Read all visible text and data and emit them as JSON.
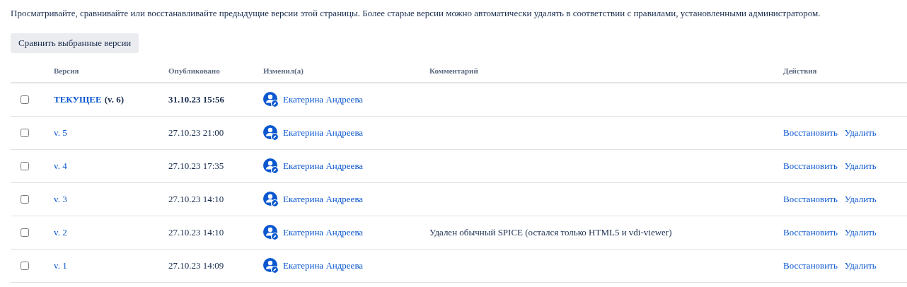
{
  "description": "Просматривайте, сравнивайте или восстанавливайте предыдущие версии этой страницы. Более старые версии можно автоматически удалять в соответствии с правилами, установленными администратором.",
  "compare_button": "Сравнить выбранные версии",
  "table": {
    "columns": [
      "Версия",
      "Опубликовано",
      "Изменил(а)",
      "Комментарий",
      "Действия"
    ],
    "rows": [
      {
        "checked": false,
        "current": true,
        "version": "ТЕКУЩЕЕ",
        "version_note": "(v. 6)",
        "published": "31.10.23 15:56",
        "author": "Екатерина Андреева",
        "actions": []
      },
      {
        "checked": false,
        "current": false,
        "version": "v. 5",
        "published": "27.10.23 21:00",
        "author": "Екатерина Андреева",
        "actions": [
          "Восстановить",
          "Удалить"
        ]
      },
      {
        "checked": false,
        "current": false,
        "version": "v. 4",
        "published": "27.10.23 17:35",
        "author": "Екатерина Андреева",
        "actions": [
          "Восстановить",
          "Удалить"
        ]
      },
      {
        "checked": false,
        "current": false,
        "version": "v. 3",
        "published": "27.10.23 14:10",
        "author": "Екатерина Андреева",
        "actions": [
          "Восстановить",
          "Удалить"
        ]
      },
      {
        "checked": false,
        "current": false,
        "version": "v. 2",
        "published": "27.10.23 14:10",
        "author": "Екатерина Андреева",
        "comment": "Удален обычный SPICE (остался только HTML5 и vdi-viewer)",
        "actions": [
          "Восстановить",
          "Удалить"
        ]
      },
      {
        "checked": false,
        "current": false,
        "version": "v. 1",
        "published": "27.10.23 14:09",
        "author": "Екатерина Андреева",
        "actions": [
          "Восстановить",
          "Удалить"
        ]
      }
    ]
  }
}
